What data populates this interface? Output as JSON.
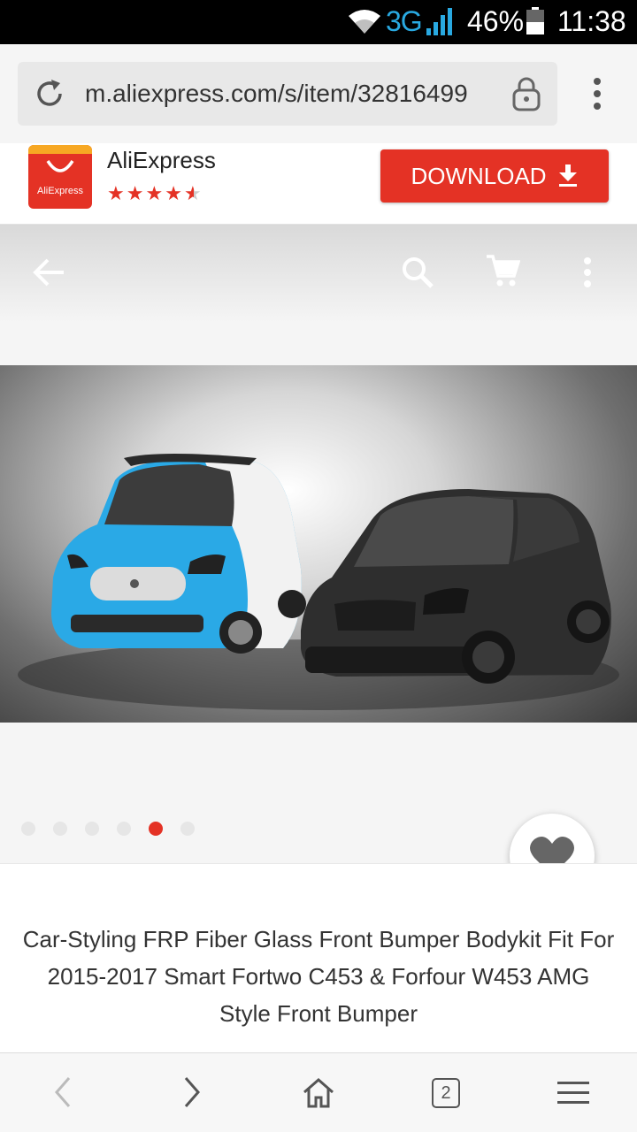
{
  "status_bar": {
    "network": "3G",
    "battery": "46%",
    "time": "11:38",
    "icons": [
      "wifi-icon",
      "signal-icon",
      "battery-icon"
    ]
  },
  "browser": {
    "url": "m.aliexpress.com/s/item/32816499",
    "tab_count": "2"
  },
  "app_banner": {
    "name": "AliExpress",
    "logo_text": "AliExpress",
    "rating": 4.5,
    "download_label": "DOWNLOAD"
  },
  "gallery": {
    "image_count": 6,
    "active_index": 4
  },
  "product": {
    "title": "Car-Styling FRP Fiber Glass Front Bumper Bodykit Fit For 2015-2017 Smart Fortwo C453 & Forfour W453 AMG Style Front Bumper"
  },
  "colors": {
    "brand": "#e43225",
    "network": "#29a9e1"
  }
}
